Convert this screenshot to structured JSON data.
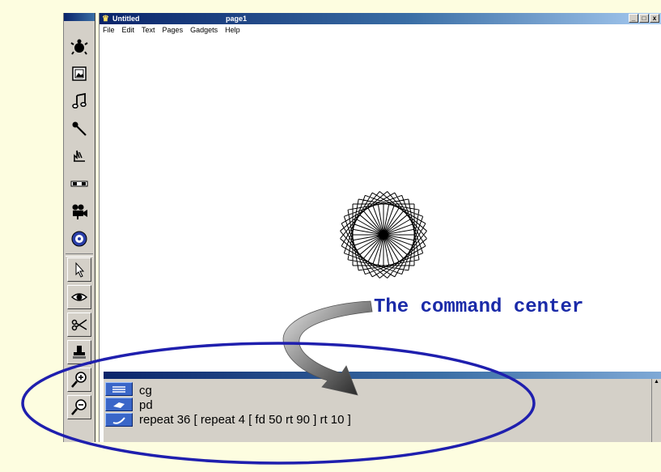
{
  "window": {
    "title": "Untitled",
    "page": "page1",
    "controls": [
      "_",
      "□",
      "x"
    ]
  },
  "menu": [
    "File",
    "Edit",
    "Text",
    "Pages",
    "Gadgets",
    "Help"
  ],
  "toolbar": {
    "icons": [
      "turtle-icon",
      "picture-icon",
      "music-note-icon",
      "microphone-icon",
      "hand-grab-icon",
      "button-icon",
      "video-camera-icon",
      "melody-icon",
      "pointer-arrow-icon",
      "eye-icon",
      "scissors-icon",
      "stamp-icon",
      "zoom-in-icon",
      "zoom-out-icon"
    ]
  },
  "annotation": {
    "text": "The command center",
    "color": "#1a2aa8"
  },
  "command_center": {
    "lines": [
      "cg",
      "pd",
      "repeat 36 [ repeat 4 [ fd 50 rt 90 ] rt 10 ]"
    ]
  },
  "colors": {
    "ellipse": "#1f1fae",
    "title_bar": "#0a246a",
    "page_bg": "#fdfde0"
  }
}
